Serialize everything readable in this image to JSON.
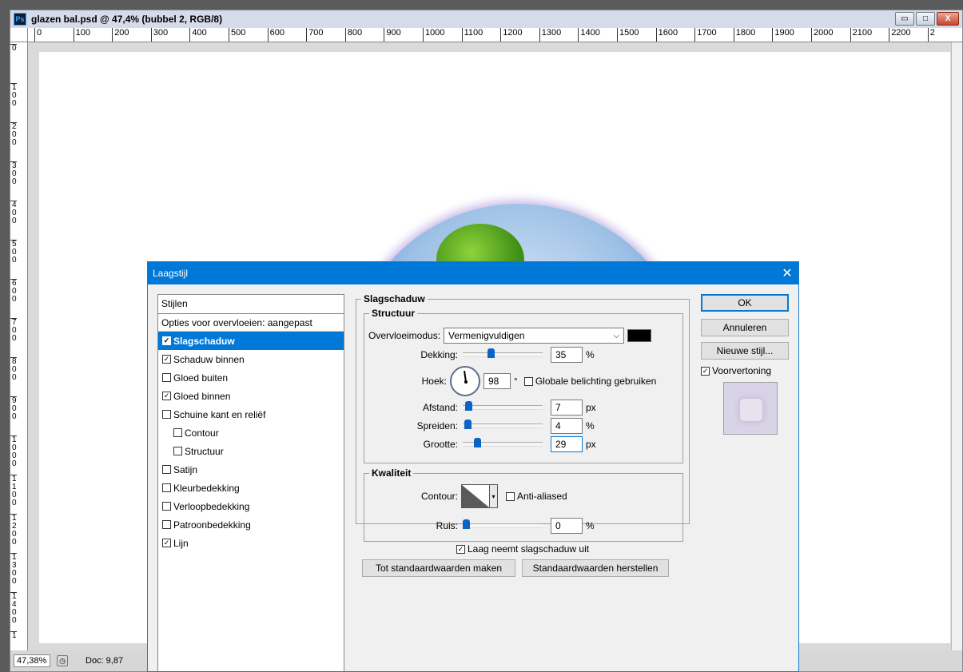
{
  "window": {
    "app_icon": "Ps",
    "title": "glazen bal.psd @ 47,4% (bubbel 2, RGB/8)",
    "controls": {
      "minimize": "▭",
      "maximize": "□",
      "close": "X"
    }
  },
  "ruler": {
    "h_ticks": [
      "0",
      "100",
      "200",
      "300",
      "400",
      "500",
      "600",
      "700",
      "800",
      "900",
      "1000",
      "1100",
      "1200",
      "1300",
      "1400",
      "1500",
      "1600",
      "1700",
      "1800",
      "1900",
      "2000",
      "2100",
      "2200",
      "2"
    ],
    "v_ticks": [
      "0",
      "100",
      "200",
      "300",
      "400",
      "500",
      "600",
      "700",
      "800",
      "900",
      "1000",
      "1100",
      "1200",
      "1300",
      "1400",
      "1"
    ]
  },
  "statusbar": {
    "zoom": "47,38%",
    "doc": "Doc: 9,87"
  },
  "dialog": {
    "title": "Laagstijl",
    "close": "✕",
    "styles_header": "Stijlen",
    "blend_options": "Opties voor overvloeien: aangepast",
    "style_items": [
      {
        "label": "Slagschaduw",
        "checked": true,
        "active": true,
        "indent": false
      },
      {
        "label": "Schaduw binnen",
        "checked": true,
        "active": false,
        "indent": false
      },
      {
        "label": "Gloed buiten",
        "checked": false,
        "active": false,
        "indent": false
      },
      {
        "label": "Gloed binnen",
        "checked": true,
        "active": false,
        "indent": false
      },
      {
        "label": "Schuine kant en reliëf",
        "checked": false,
        "active": false,
        "indent": false
      },
      {
        "label": "Contour",
        "checked": false,
        "active": false,
        "indent": true
      },
      {
        "label": "Structuur",
        "checked": false,
        "active": false,
        "indent": true
      },
      {
        "label": "Satijn",
        "checked": false,
        "active": false,
        "indent": false
      },
      {
        "label": "Kleurbedekking",
        "checked": false,
        "active": false,
        "indent": false
      },
      {
        "label": "Verloopbedekking",
        "checked": false,
        "active": false,
        "indent": false
      },
      {
        "label": "Patroonbedekking",
        "checked": false,
        "active": false,
        "indent": false
      },
      {
        "label": "Lijn",
        "checked": true,
        "active": false,
        "indent": false
      }
    ],
    "section_title": "Slagschaduw",
    "structure": {
      "label": "Structuur",
      "blend_mode_label": "Overvloeimodus:",
      "blend_mode_value": "Vermenigvuldigen",
      "shadow_color": "#000000",
      "opacity_label": "Dekking:",
      "opacity_value": "35",
      "opacity_unit": "%",
      "opacity_level": 0.35,
      "angle_label": "Hoek:",
      "angle_value": "98",
      "angle_unit": "°",
      "global_light_label": "Globale belichting gebruiken",
      "global_light_checked": false,
      "distance_label": "Afstand:",
      "distance_value": "7",
      "distance_unit": "px",
      "spread_label": "Spreiden:",
      "spread_value": "4",
      "spread_unit": "%",
      "size_label": "Grootte:",
      "size_value": "29",
      "size_unit": "px"
    },
    "quality": {
      "label": "Kwaliteit",
      "contour_label": "Contour:",
      "antialias_label": "Anti-aliased",
      "antialias_checked": false,
      "noise_label": "Ruis:",
      "noise_value": "0",
      "noise_unit": "%"
    },
    "knockout_label": "Laag neemt slagschaduw uit",
    "knockout_checked": true,
    "make_default": "Tot standaardwaarden maken",
    "reset_default": "Standaardwaarden herstellen",
    "buttons": {
      "ok": "OK",
      "cancel": "Annuleren",
      "new_style": "Nieuwe stijl...",
      "preview_label": "Voorvertoning",
      "preview_checked": true
    }
  },
  "colors": {
    "dialog_accent": "#0078d7",
    "slider_thumb": "#0a64c8"
  }
}
